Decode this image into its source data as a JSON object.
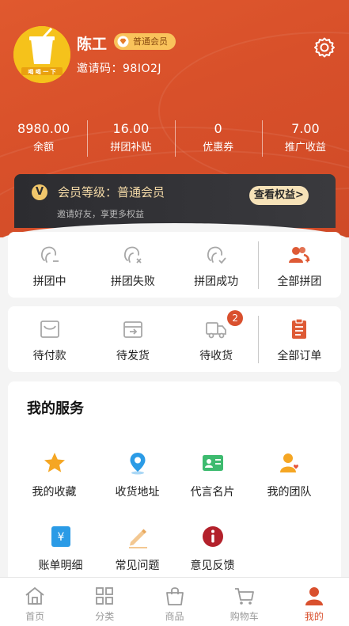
{
  "profile": {
    "name": "陈工",
    "badge": "普通会员",
    "invite": "邀请码：98IO2J",
    "avatar_text": "喝 喝 一 下"
  },
  "stats": [
    {
      "value": "8980.00",
      "label": "余额"
    },
    {
      "value": "16.00",
      "label": "拼团补贴"
    },
    {
      "value": "0",
      "label": "优惠券"
    },
    {
      "value": "7.00",
      "label": "推广收益"
    }
  ],
  "member": {
    "icon_letter": "V",
    "title": "会员等级：普通会员",
    "subtitle": "邀请好友，享更多权益",
    "button": "查看权益>"
  },
  "group": [
    {
      "label": "拼团中",
      "icon": "group-pending-icon"
    },
    {
      "label": "拼团失败",
      "icon": "group-failed-icon"
    },
    {
      "label": "拼团成功",
      "icon": "group-success-icon"
    },
    {
      "label": "全部拼团",
      "icon": "all-groups-icon"
    }
  ],
  "orders": [
    {
      "label": "待付款",
      "icon": "wallet-icon"
    },
    {
      "label": "待发货",
      "icon": "ship-box-icon",
      "badge": "2"
    },
    {
      "label": "待收货",
      "icon": "truck-icon"
    },
    {
      "label": "全部订单",
      "icon": "clipboard-icon"
    }
  ],
  "services": {
    "title": "我的服务",
    "items": [
      {
        "label": "我的收藏",
        "icon": "star-icon"
      },
      {
        "label": "收货地址",
        "icon": "location-icon"
      },
      {
        "label": "代言名片",
        "icon": "business-card-icon"
      },
      {
        "label": "我的团队",
        "icon": "team-icon"
      },
      {
        "label": "账单明细",
        "icon": "bill-icon"
      },
      {
        "label": "常见问题",
        "icon": "pencil-icon"
      },
      {
        "label": "意见反馈",
        "icon": "info-icon"
      }
    ]
  },
  "tabbar": [
    {
      "label": "首页",
      "icon": "home-icon"
    },
    {
      "label": "分类",
      "icon": "category-icon"
    },
    {
      "label": "商品",
      "icon": "bag-icon"
    },
    {
      "label": "购物车",
      "icon": "cart-icon"
    },
    {
      "label": "我的",
      "icon": "user-icon",
      "active": true
    }
  ],
  "colors": {
    "brand": "#d9502e",
    "badge_bg": "#f9c35b",
    "member_bg": "#2c2c30",
    "member_text": "#f3d9a6"
  }
}
